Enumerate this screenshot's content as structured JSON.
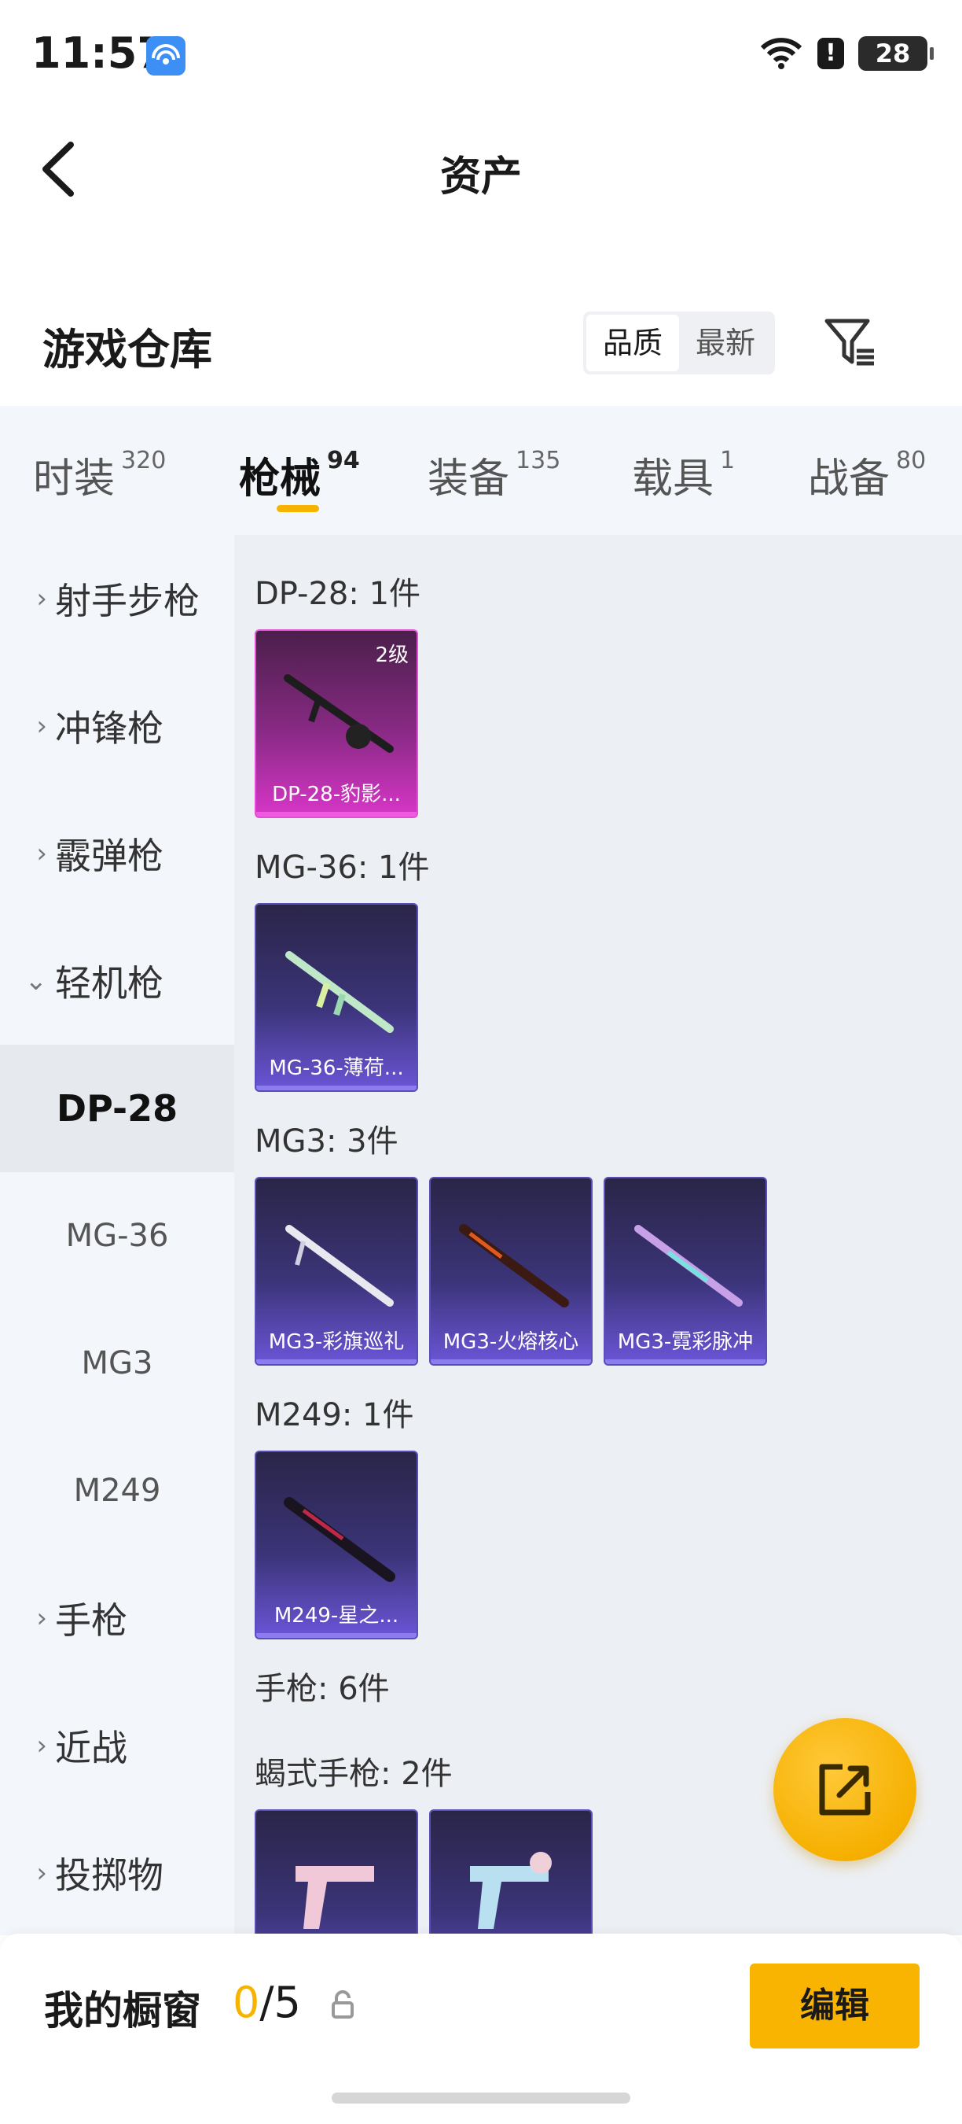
{
  "status_bar": {
    "time": "11:57",
    "battery": "28"
  },
  "header": {
    "title": "资产"
  },
  "warehouse": {
    "title": "游戏仓库",
    "sort_options": [
      {
        "label": "品质",
        "active": true
      },
      {
        "label": "最新",
        "active": false
      }
    ]
  },
  "category_tabs": [
    {
      "label": "时装",
      "count": "320",
      "active": false
    },
    {
      "label": "枪械",
      "count": "94",
      "active": true
    },
    {
      "label": "装备",
      "count": "135",
      "active": false
    },
    {
      "label": "载具",
      "count": "1",
      "active": false
    },
    {
      "label": "战备",
      "count": "80",
      "active": false
    }
  ],
  "sidebar": {
    "items": [
      {
        "label": "射手步枪",
        "expanded": false
      },
      {
        "label": "冲锋枪",
        "expanded": false
      },
      {
        "label": "霰弹枪",
        "expanded": false
      },
      {
        "label": "轻机枪",
        "expanded": true
      },
      {
        "label": "手枪",
        "expanded": false
      },
      {
        "label": "近战",
        "expanded": false
      },
      {
        "label": "投掷物",
        "expanded": false
      }
    ],
    "sub_items": [
      {
        "label": "DP-28",
        "active": true
      },
      {
        "label": "MG-36",
        "active": false
      },
      {
        "label": "MG3",
        "active": false
      },
      {
        "label": "M249",
        "active": false
      }
    ]
  },
  "groups": [
    {
      "label": "DP-28: 1件",
      "items": [
        {
          "name": "DP-28-豹影...",
          "level": "2级",
          "rarity": "pink"
        }
      ]
    },
    {
      "label": "MG-36: 1件",
      "items": [
        {
          "name": "MG-36-薄荷...",
          "rarity": "purple"
        }
      ]
    },
    {
      "label": "MG3: 3件",
      "items": [
        {
          "name": "MG3-彩旗巡礼",
          "rarity": "purple"
        },
        {
          "name": "MG3-火熔核心",
          "rarity": "purple"
        },
        {
          "name": "MG3-霓彩脉冲",
          "rarity": "purple"
        }
      ]
    },
    {
      "label": "M249: 1件",
      "items": [
        {
          "name": "M249-星之...",
          "rarity": "purple"
        }
      ]
    },
    {
      "label": "手枪: 6件",
      "items": []
    },
    {
      "label": "蝎式手枪: 2件",
      "items": [
        {
          "name": "",
          "rarity": "purple"
        },
        {
          "name": "",
          "rarity": "purple"
        }
      ]
    }
  ],
  "bottom_bar": {
    "title": "我的橱窗",
    "count_used": "0",
    "count_total": "/5",
    "edit_label": "编辑"
  },
  "colors": {
    "accent": "#f6b400",
    "pink_card": "#d836c8",
    "purple_card": "#6b55d8"
  }
}
